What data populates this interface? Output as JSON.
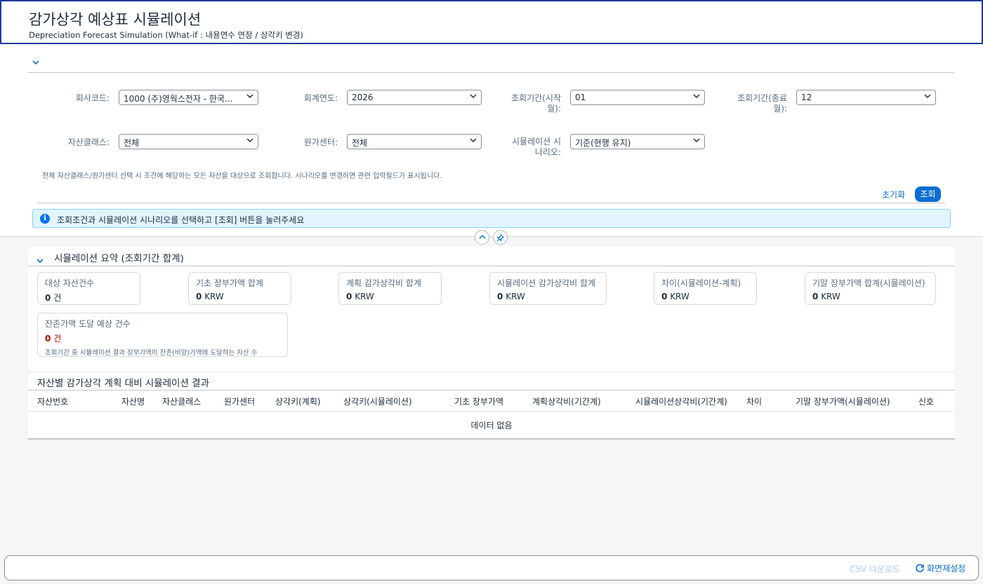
{
  "header": {
    "title": "감가상각 예상표 시뮬레이션",
    "subtitle": "Depreciation Forecast Simulation (What-if : 내용연수 연장 / 상각키 변경)"
  },
  "filters": {
    "company_code": {
      "label": "회사코드:",
      "value": "1000 (주)영웍스전자 - 한국..."
    },
    "fiscal_year": {
      "label": "회계연도:",
      "value": "2026"
    },
    "period_from": {
      "label": "조회기간(시작\n월):",
      "value": "01"
    },
    "period_to": {
      "label": "조회기간(종료\n월):",
      "value": "12"
    },
    "asset_class": {
      "label": "자산클래스:",
      "value": "전체"
    },
    "cost_center": {
      "label": "원가센터:",
      "value": "전체"
    },
    "scenario": {
      "label": "시뮬레이션 시\n나리오:",
      "value": "기준(현행 유지)"
    },
    "hint": "전체 자산클래스/원가센터 선택 시 조건에 해당하는 모든 자산을 대상으로 조회합니다. 시나리오를 변경하면 관련 입력필드가 표시됩니다.",
    "reset_label": "초기화",
    "go_label": "조회"
  },
  "message_strip": {
    "icon": "info-icon",
    "text": "조회조건과 시뮬레이션 시나리오를 선택하고 [조회] 버튼을 눌러주세요"
  },
  "summary": {
    "title": "시뮬레이션 요약 (조회기간 합계)",
    "kpis": [
      {
        "label": "대상 자산건수",
        "value": "0",
        "unit": "건"
      },
      {
        "label": "기초 장부가액 합계",
        "value": "0",
        "unit": "KRW"
      },
      {
        "label": "계획 감가상각비 합계",
        "value": "0",
        "unit": "KRW"
      },
      {
        "label": "시뮬레이션 감가상각비 합계",
        "value": "0",
        "unit": "KRW"
      },
      {
        "label": "차이(시뮬레이션-계획)",
        "value": "0",
        "unit": "KRW"
      },
      {
        "label": "기말 장부가액 합계(시뮬레이션)",
        "value": "0",
        "unit": "KRW"
      }
    ],
    "residual": {
      "label": "잔존가액 도달 예상 건수",
      "value": "0",
      "unit": "건",
      "value_color": "#bb0000",
      "description": "조회기간 중 시뮬레이션 결과 장부가액이 잔존(비망)가액에 도달하는 자산 수"
    }
  },
  "table": {
    "title": "자산별 감가상각 계획 대비 시뮬레이션 결과",
    "columns": [
      "자산번호",
      "자산명",
      "자산클래스",
      "원가센터",
      "상각키(계획)",
      "상각키(시뮬레이션)",
      "기초 장부가액",
      "계획상각비(기간계)",
      "시뮬레이션상각비(기간계)",
      "차이",
      "기말 장부가액(시뮬레이션)",
      "신호"
    ],
    "no_data": "데이터 없음"
  },
  "footer": {
    "csv_label": "CSV 다운로드",
    "reset_view_label": "화면재설정"
  },
  "colors": {
    "accent": "#0a6ed1",
    "title_border": "#1b3b9c",
    "info_bg": "#e1f4ff",
    "negative": "#bb0000"
  }
}
